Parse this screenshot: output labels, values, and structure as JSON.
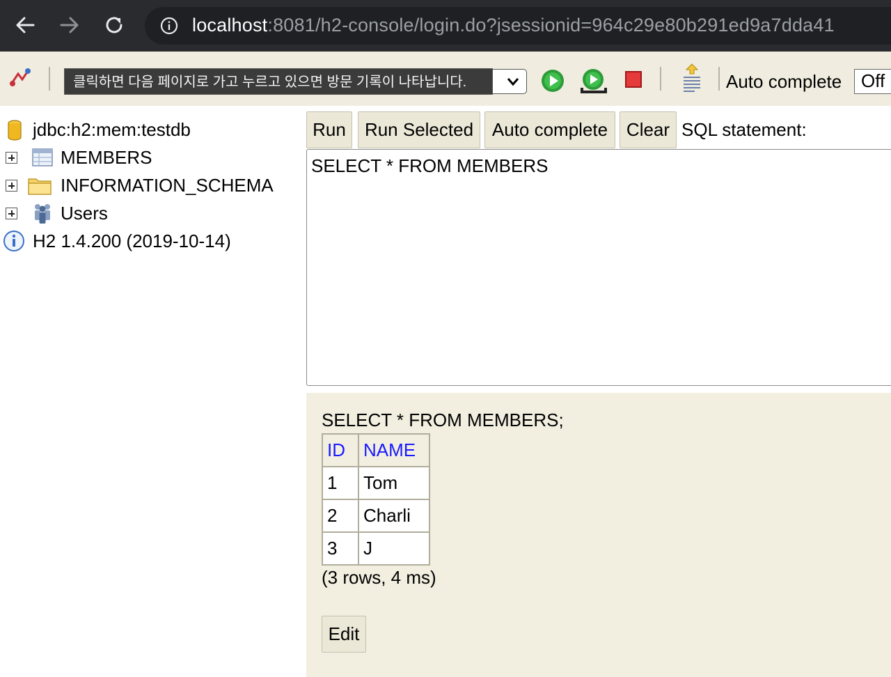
{
  "browser": {
    "url_host": "localhost",
    "url_rest": ":8081/h2-console/login.do?jsessionid=964c29e80b291ed9a7dda41"
  },
  "toolbar": {
    "tooltip": "클릭하면 다음 페이지로 가고 누르고 있으면 방문 기록이 나타납니다.",
    "autocomplete_label": "Auto complete",
    "autocomplete_value": "Off"
  },
  "tree": {
    "items": [
      {
        "label": "jdbc:h2:mem:testdb",
        "icon": "database-icon"
      },
      {
        "label": "MEMBERS",
        "icon": "table-icon"
      },
      {
        "label": "INFORMATION_SCHEMA",
        "icon": "folder-icon"
      },
      {
        "label": "Users",
        "icon": "users-icon"
      },
      {
        "label": "H2 1.4.200 (2019-10-14)",
        "icon": "info-icon"
      }
    ]
  },
  "query": {
    "buttons": {
      "run": "Run",
      "run_selected": "Run Selected",
      "auto_complete": "Auto complete",
      "clear": "Clear"
    },
    "sql_label": "SQL statement:",
    "sql_text": "SELECT * FROM MEMBERS"
  },
  "result": {
    "statement": "SELECT * FROM MEMBERS;",
    "columns": [
      "ID",
      "NAME"
    ],
    "rows": [
      [
        "1",
        "Tom"
      ],
      [
        "2",
        "Charli"
      ],
      [
        "3",
        "J"
      ]
    ],
    "summary": "(3 rows, 4 ms)",
    "edit_label": "Edit"
  },
  "colors": {
    "chrome_bg": "#2a2b2e",
    "panel_bg": "#f2efe1",
    "header_link": "#1a1aff",
    "run_green": "#2e9b3a",
    "stop_red": "#d92b2b"
  }
}
